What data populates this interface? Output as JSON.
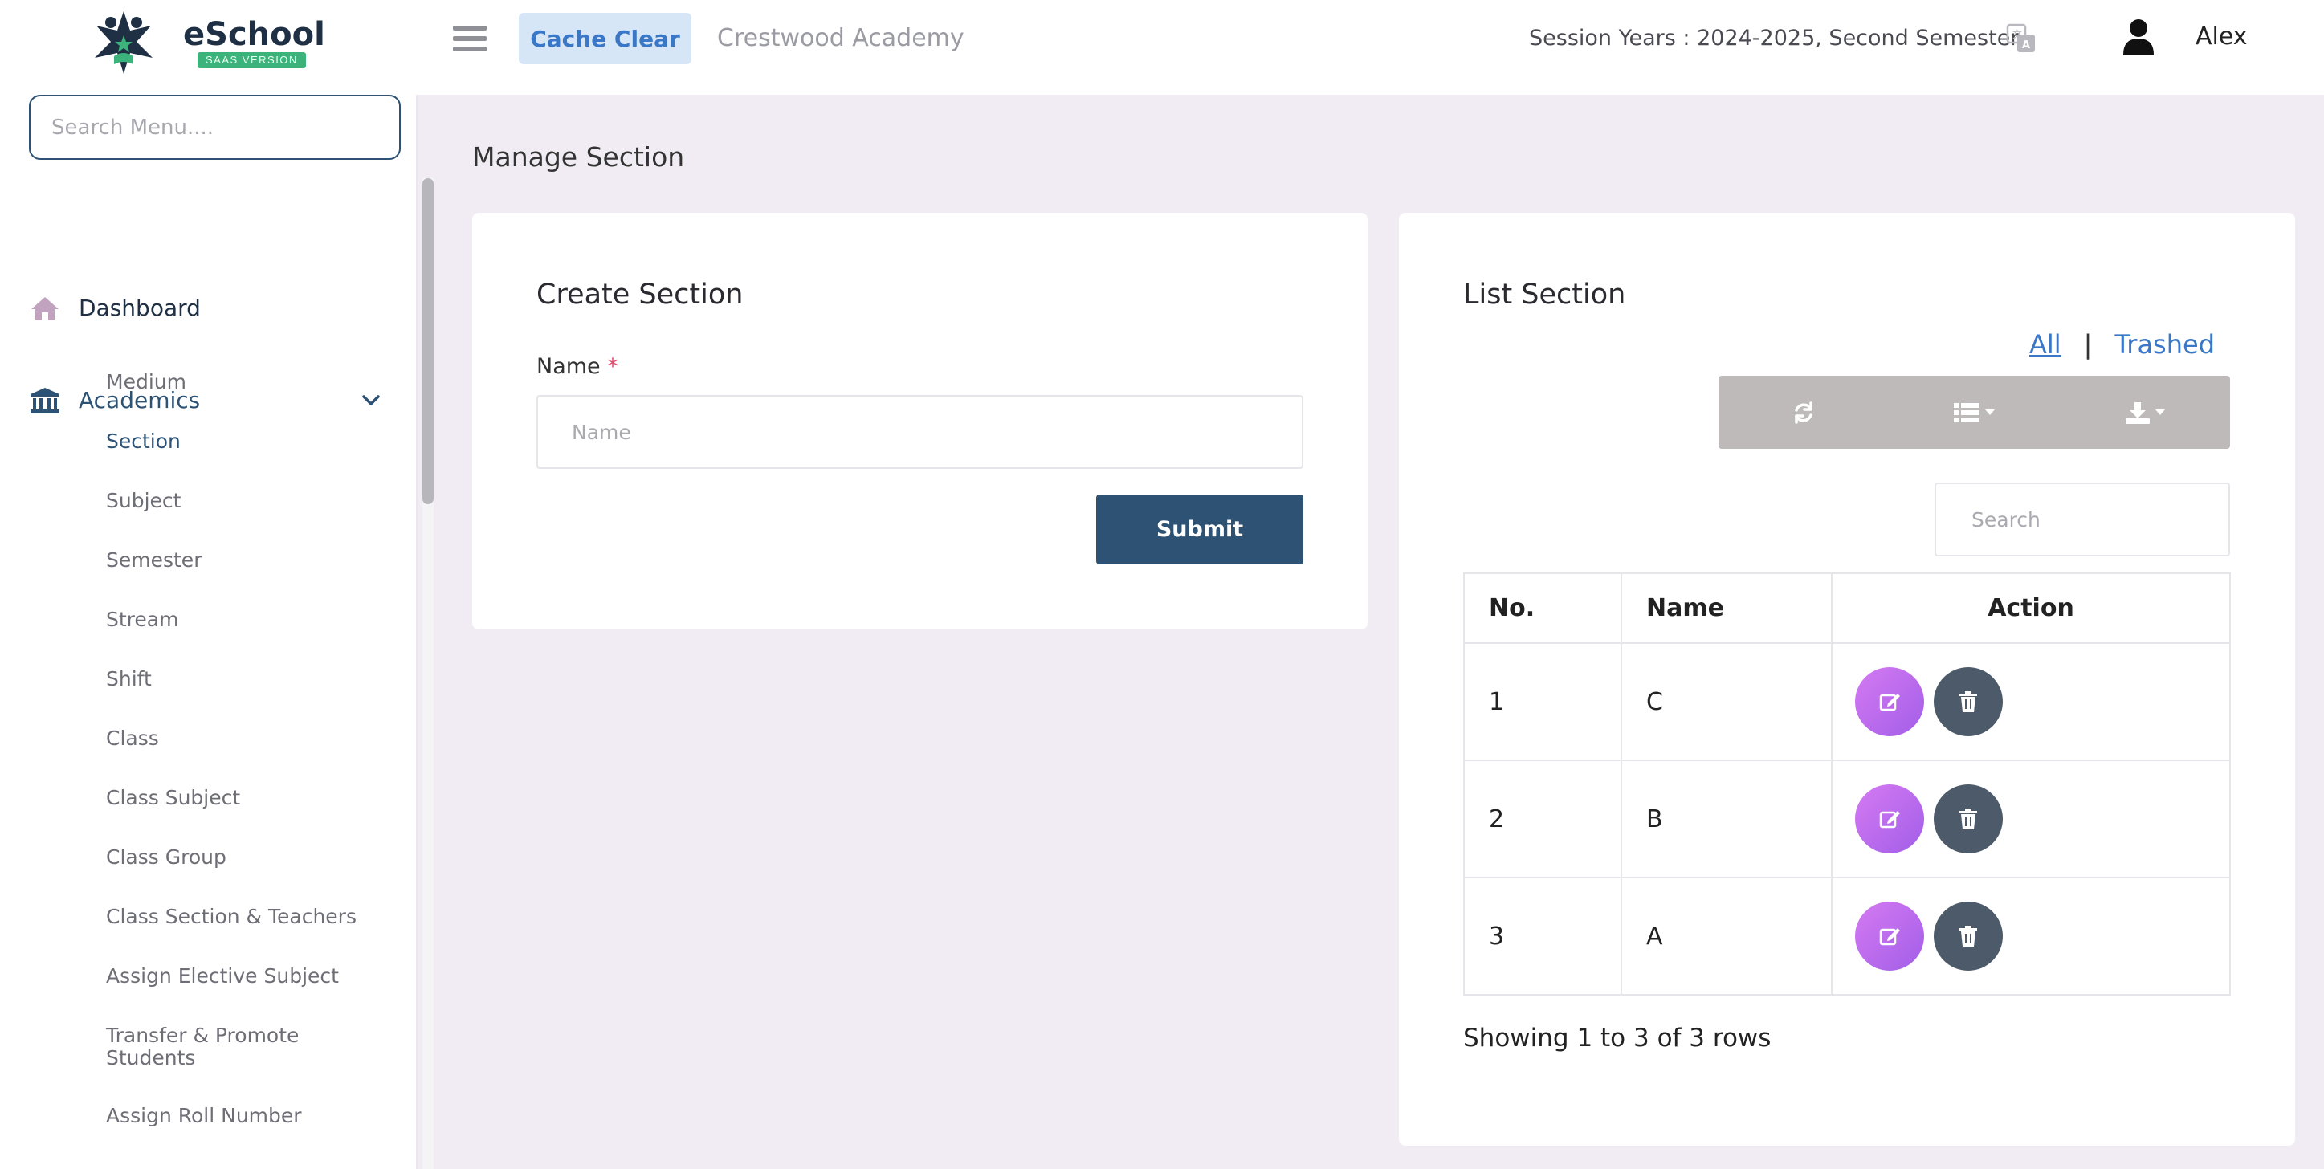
{
  "brand": {
    "name": "eSchool",
    "badge": "SAAS VERSION"
  },
  "header": {
    "cache_clear_label": "Cache Clear",
    "school_name": "Crestwood Academy",
    "session_text": "Session Years : 2024-2025, Second Semester",
    "user_name": "Alex"
  },
  "sidebar": {
    "search_placeholder": "Search Menu....",
    "dashboard_label": "Dashboard",
    "academics_label": "Academics",
    "sub_items": [
      "Medium",
      "Section",
      "Subject",
      "Semester",
      "Stream",
      "Shift",
      "Class",
      "Class Subject",
      "Class Group",
      "Class Section & Teachers",
      "Assign Elective Subject",
      "Transfer & Promote Students",
      "Assign Roll Number"
    ],
    "active_item": "Section"
  },
  "page": {
    "title": "Manage Section"
  },
  "create_card": {
    "title": "Create Section",
    "name_label": "Name",
    "required_marker": "*",
    "name_placeholder": "Name",
    "submit_label": "Submit"
  },
  "list_card": {
    "title": "List Section",
    "filter_all": "All",
    "filter_separator": "|",
    "filter_trashed": "Trashed",
    "search_placeholder": "Search",
    "columns": [
      "No.",
      "Name",
      "Action"
    ],
    "rows": [
      {
        "no": "1",
        "name": "C"
      },
      {
        "no": "2",
        "name": "B"
      },
      {
        "no": "3",
        "name": "A"
      }
    ],
    "footer": "Showing 1 to 3 of 3 rows"
  },
  "colors": {
    "primary": "#2d5273",
    "accent_link": "#3a78c7",
    "edit_button": "#b86cee",
    "delete_button": "#4c5a69",
    "toolbar": "#bdbab9",
    "page_background": "#f1ecf3"
  },
  "icons": {
    "toolbar": [
      "refresh-icon",
      "columns-icon",
      "export-icon"
    ],
    "row_actions": [
      "edit-icon",
      "trash-icon"
    ]
  }
}
